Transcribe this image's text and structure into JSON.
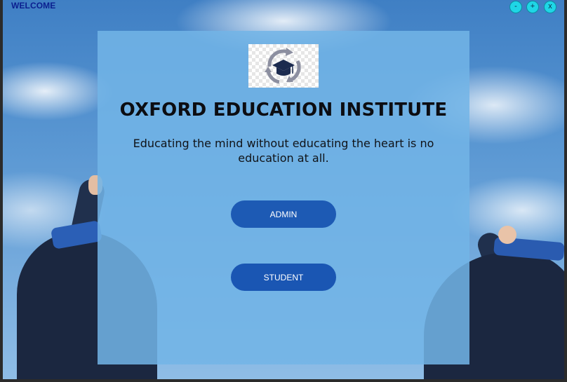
{
  "window": {
    "title": "WELCOME",
    "controls": {
      "minimize": "-",
      "maximize": "+",
      "close": "x"
    }
  },
  "panel": {
    "logo_icon": "graduation-cap-recycle-icon",
    "institute_name": "OXFORD EDUCATION INSTITUTE",
    "motto": "Educating the mind without educating the heart is no education at all.",
    "buttons": {
      "admin": "ADMIN",
      "student": "STUDENT"
    }
  },
  "colors": {
    "panel_bg": "#72b4e6",
    "button_bg": "#1d5ab4",
    "window_control": "#1fd6e6",
    "title_text": "#0b1f8f"
  }
}
